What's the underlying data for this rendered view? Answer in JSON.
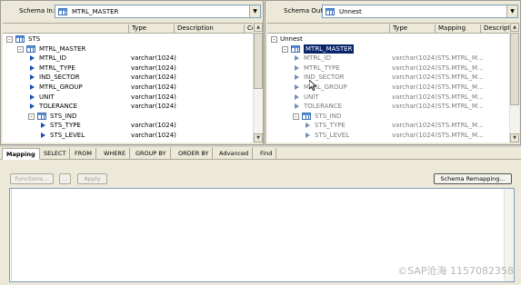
{
  "left": {
    "schema_label": "Schema In:",
    "schema_value": "MTRL_MASTER",
    "columns": [
      "Type",
      "Description",
      "Co"
    ],
    "rows": [
      {
        "name": "STS",
        "type": "",
        "level": 0,
        "kind": "table",
        "expander": "-"
      },
      {
        "name": "MTRL_MASTER",
        "type": "",
        "level": 1,
        "kind": "table",
        "expander": "-"
      },
      {
        "name": "MTRL_ID",
        "type": "varchar(1024)",
        "level": 2,
        "kind": "column"
      },
      {
        "name": "MTRL_TYPE",
        "type": "varchar(1024)",
        "level": 2,
        "kind": "column"
      },
      {
        "name": "IND_SECTOR",
        "type": "varchar(1024)",
        "level": 2,
        "kind": "column"
      },
      {
        "name": "MTRL_GROUP",
        "type": "varchar(1024)",
        "level": 2,
        "kind": "column"
      },
      {
        "name": "UNIT",
        "type": "varchar(1024)",
        "level": 2,
        "kind": "column"
      },
      {
        "name": "TOLERANCE",
        "type": "varchar(1024)",
        "level": 2,
        "kind": "column"
      },
      {
        "name": "STS_IND",
        "type": "",
        "level": 2,
        "kind": "table",
        "expander": "-"
      },
      {
        "name": "STS_TYPE",
        "type": "varchar(1024)",
        "level": 3,
        "kind": "column"
      },
      {
        "name": "STS_LEVEL",
        "type": "varchar(1024)",
        "level": 3,
        "kind": "column"
      }
    ]
  },
  "right": {
    "schema_label": "Schema Out:",
    "schema_value": "Unnest",
    "columns": [
      "Type",
      "Mapping",
      "Description"
    ],
    "rows": [
      {
        "name": "Unnest",
        "type": "",
        "map": "",
        "level": 0,
        "kind": "none",
        "expander": "-"
      },
      {
        "name": "MTRL_MASTER",
        "type": "",
        "map": "",
        "level": 1,
        "kind": "table",
        "expander": "-",
        "selected": true
      },
      {
        "name": "MTRL_ID",
        "type": "varchar(1024)",
        "map": "STS.MTRL_M...",
        "level": 2,
        "kind": "column",
        "dim": true
      },
      {
        "name": "MTRL_TYPE",
        "type": "varchar(1024)",
        "map": "STS.MTRL_M...",
        "level": 2,
        "kind": "column",
        "dim": true
      },
      {
        "name": "IND_SECTOR",
        "type": "varchar(1024)",
        "map": "STS.MTRL_M...",
        "level": 2,
        "kind": "column",
        "dim": true
      },
      {
        "name": "MTRL_GROUP",
        "type": "varchar(1024)",
        "map": "STS.MTRL_M...",
        "level": 2,
        "kind": "column",
        "dim": true
      },
      {
        "name": "UNIT",
        "type": "varchar(1024)",
        "map": "STS.MTRL_M...",
        "level": 2,
        "kind": "column",
        "dim": true
      },
      {
        "name": "TOLERANCE",
        "type": "varchar(1024)",
        "map": "STS.MTRL_M...",
        "level": 2,
        "kind": "column",
        "dim": true
      },
      {
        "name": "STS_IND",
        "type": "",
        "map": "",
        "level": 2,
        "kind": "table",
        "expander": "-",
        "dim": true
      },
      {
        "name": "STS_TYPE",
        "type": "varchar(1024)",
        "map": "STS.MTRL_M...",
        "level": 3,
        "kind": "column",
        "dim": true
      },
      {
        "name": "STS_LEVEL",
        "type": "varchar(1024)",
        "map": "STS.MTRL_M...",
        "level": 3,
        "kind": "column",
        "dim": true
      }
    ]
  },
  "tabs": [
    "Mapping",
    "SELECT",
    "FROM",
    "WHERE",
    "GROUP BY",
    "ORDER BY",
    "Advanced",
    "Find"
  ],
  "active_tab": "Mapping",
  "buttons": {
    "functions": "Functions...",
    "ellipsis": "...",
    "apply": "Apply",
    "schema_remapping": "Schema Remapping..."
  },
  "watermark": "©SAP沧海 1157082358",
  "icons": {
    "table": "table-icon",
    "column": "column-arrow-icon",
    "expander": "tree-collapse-icon",
    "dropdown": "chevron-down-icon"
  }
}
